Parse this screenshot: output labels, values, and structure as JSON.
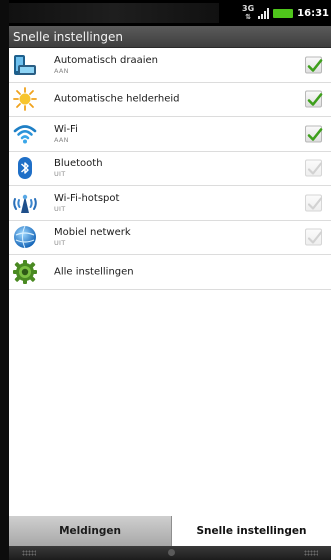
{
  "status_bar": {
    "network_type_top": "3G",
    "network_type_bottom": "⇅",
    "time": "16:31"
  },
  "header": {
    "title": "Snelle instellingen"
  },
  "settings": [
    {
      "title": "Automatisch draaien",
      "subtitle": "AAN",
      "icon": "rotate-screen-icon",
      "checked": true
    },
    {
      "title": "Automatische helderheid",
      "subtitle": "",
      "icon": "brightness-sun-icon",
      "checked": true
    },
    {
      "title": "Wi-Fi",
      "subtitle": "AAN",
      "icon": "wifi-icon",
      "checked": true
    },
    {
      "title": "Bluetooth",
      "subtitle": "UIT",
      "icon": "bluetooth-icon",
      "checked": false
    },
    {
      "title": "Wi-Fi-hotspot",
      "subtitle": "UIT",
      "icon": "wifi-hotspot-icon",
      "checked": false
    },
    {
      "title": "Mobiel netwerk",
      "subtitle": "UIT",
      "icon": "mobile-network-globe-icon",
      "checked": false
    },
    {
      "title": "Alle instellingen",
      "subtitle": "",
      "icon": "gear-icon",
      "checked": null
    }
  ],
  "tabs": {
    "notifications_label": "Meldingen",
    "quick_settings_label": "Snelle instellingen"
  },
  "colors": {
    "check_green": "#3e9f1c",
    "check_disabled": "#cfcfcf",
    "battery_green": "#4fc61b"
  }
}
